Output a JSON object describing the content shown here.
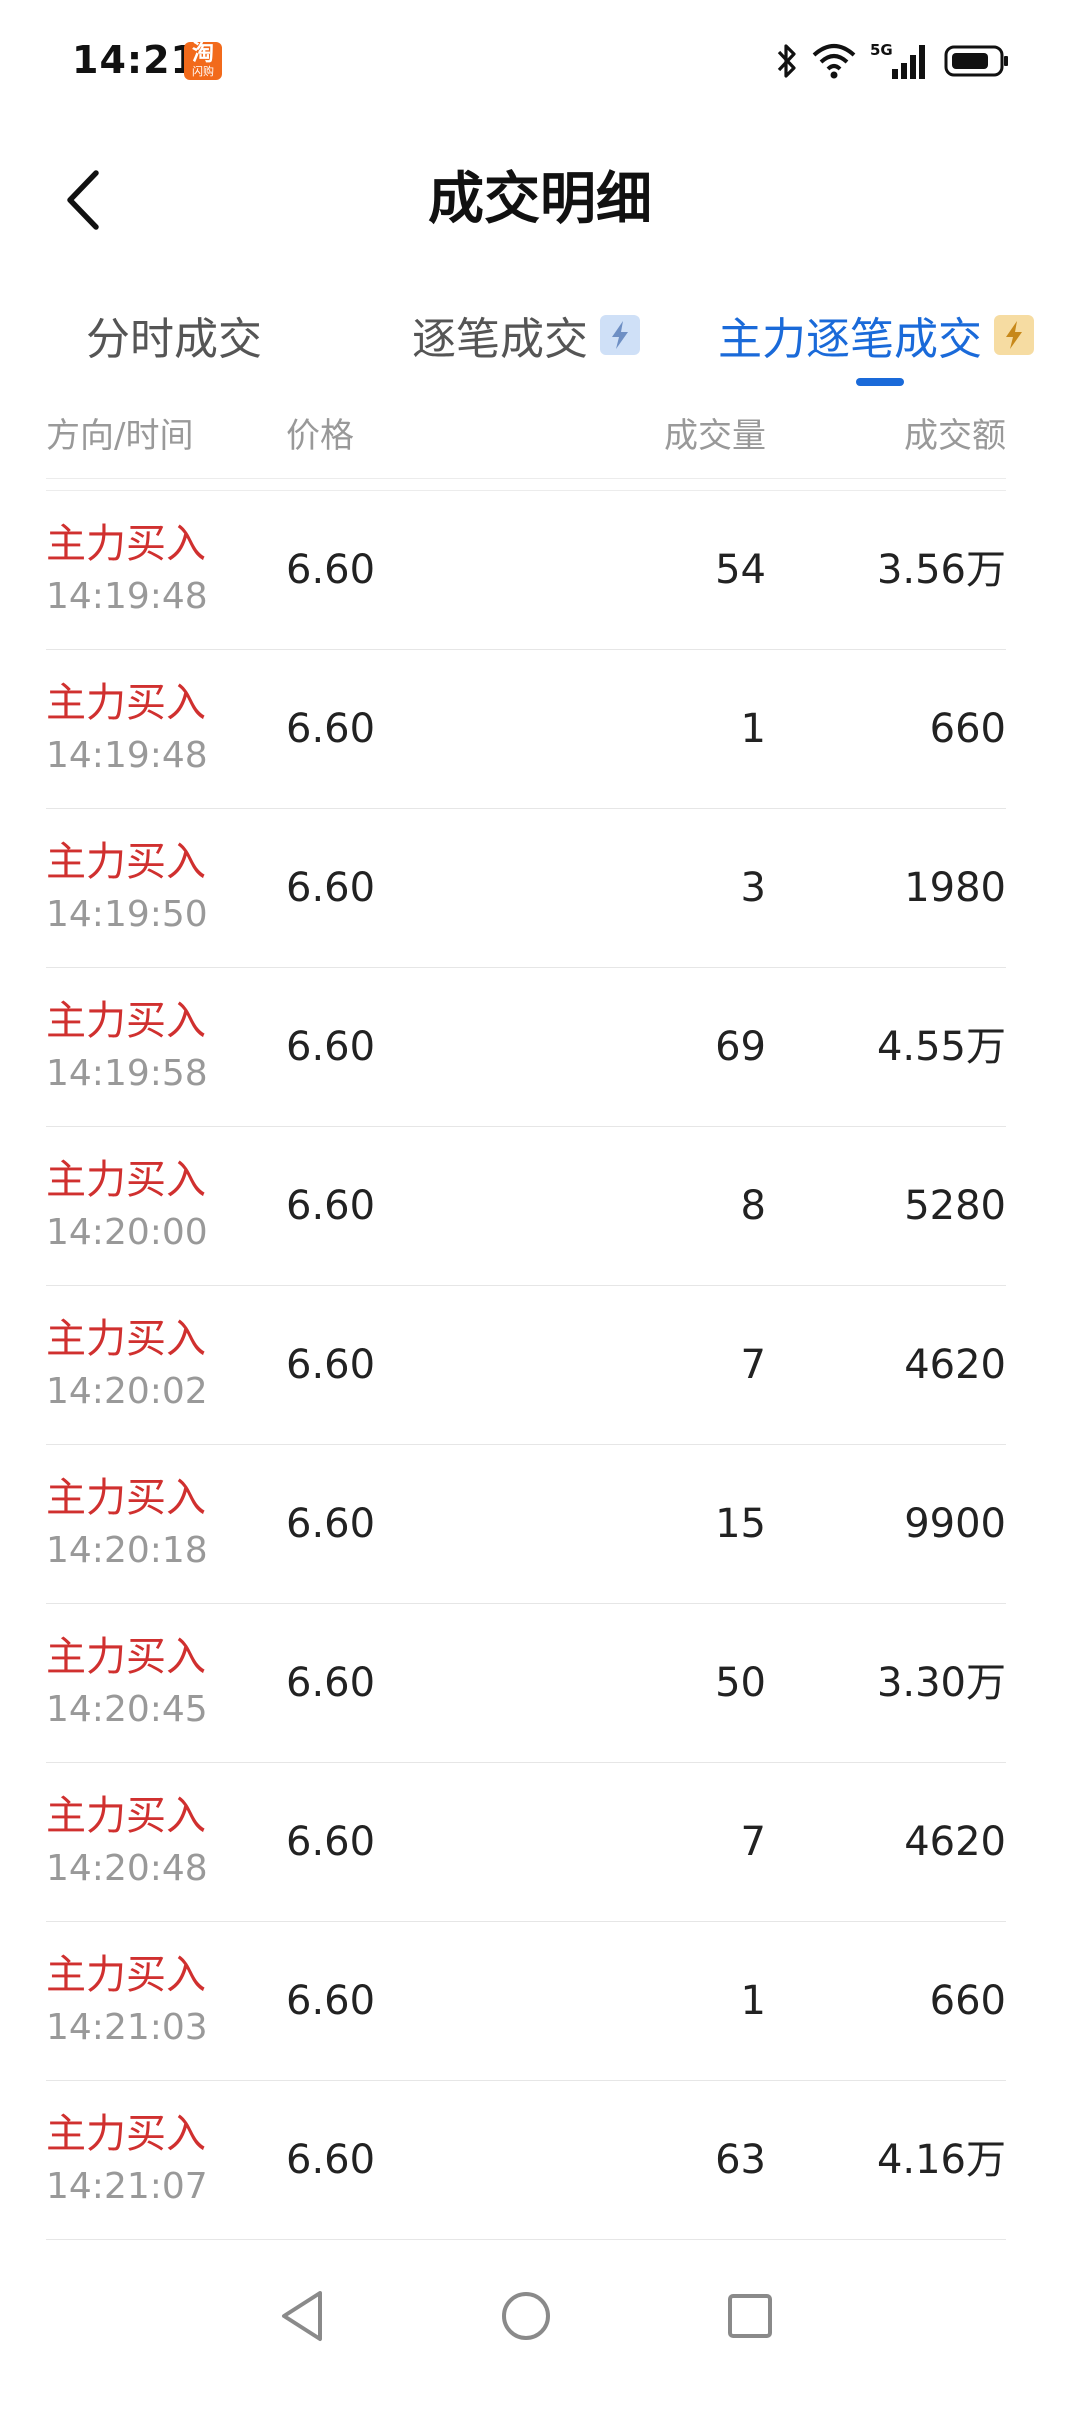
{
  "status_bar": {
    "time": "14:21",
    "badge_top": "淘",
    "badge_bottom": "闪购",
    "network": "5G"
  },
  "header": {
    "title": "成交明细"
  },
  "tabs": [
    {
      "label": "分时成交",
      "active": false
    },
    {
      "label": "逐笔成交",
      "active": false,
      "icon": "flash-icon"
    },
    {
      "label": "主力逐笔成交",
      "active": true,
      "icon": "flash-icon"
    }
  ],
  "columns": {
    "direction_time": "方向/时间",
    "price": "价格",
    "volume": "成交量",
    "amount": "成交额"
  },
  "trades": [
    {
      "direction": "主力买入",
      "time": "14:19:48",
      "price": "6.60",
      "volume": "54",
      "amount": "3.56万"
    },
    {
      "direction": "主力买入",
      "time": "14:19:48",
      "price": "6.60",
      "volume": "1",
      "amount": "660"
    },
    {
      "direction": "主力买入",
      "time": "14:19:50",
      "price": "6.60",
      "volume": "3",
      "amount": "1980"
    },
    {
      "direction": "主力买入",
      "time": "14:19:58",
      "price": "6.60",
      "volume": "69",
      "amount": "4.55万"
    },
    {
      "direction": "主力买入",
      "time": "14:20:00",
      "price": "6.60",
      "volume": "8",
      "amount": "5280"
    },
    {
      "direction": "主力买入",
      "time": "14:20:02",
      "price": "6.60",
      "volume": "7",
      "amount": "4620"
    },
    {
      "direction": "主力买入",
      "time": "14:20:18",
      "price": "6.60",
      "volume": "15",
      "amount": "9900"
    },
    {
      "direction": "主力买入",
      "time": "14:20:45",
      "price": "6.60",
      "volume": "50",
      "amount": "3.30万"
    },
    {
      "direction": "主力买入",
      "time": "14:20:48",
      "price": "6.60",
      "volume": "7",
      "amount": "4620"
    },
    {
      "direction": "主力买入",
      "time": "14:21:03",
      "price": "6.60",
      "volume": "1",
      "amount": "660"
    },
    {
      "direction": "主力买入",
      "time": "14:21:07",
      "price": "6.60",
      "volume": "63",
      "amount": "4.16万"
    }
  ],
  "colors": {
    "accent": "#1a6ad9",
    "buy": "#d0302f",
    "muted": "#999999"
  }
}
